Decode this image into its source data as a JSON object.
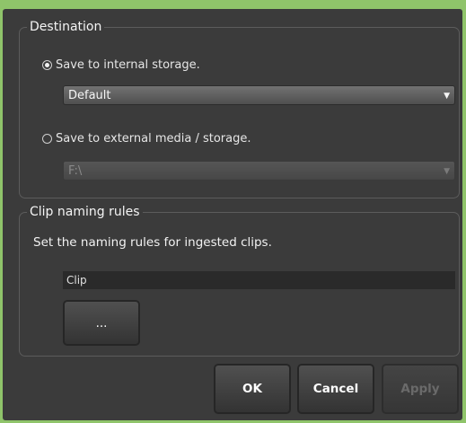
{
  "destination": {
    "legend": "Destination",
    "internal_option_label": "Save to internal storage.",
    "internal_selected": true,
    "internal_value": "Default",
    "external_option_label": "Save to external media / storage.",
    "external_selected": false,
    "external_value": "F:\\"
  },
  "clip_naming": {
    "legend": "Clip naming rules",
    "description": "Set the naming rules for ingested clips.",
    "name_value": "Clip",
    "browse_label": "..."
  },
  "buttons": {
    "ok": "OK",
    "cancel": "Cancel",
    "apply": "Apply"
  },
  "icons": {
    "dropdown": "chevron-down-icon",
    "radio_selected": "radio-selected-icon",
    "radio_unselected": "radio-unselected-icon"
  },
  "colors": {
    "background": "#8fc46a",
    "panel": "#3b3b3b"
  }
}
